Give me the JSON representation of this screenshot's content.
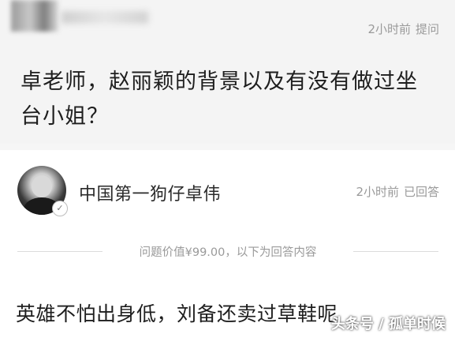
{
  "question": {
    "time_ago": "2小时前",
    "action": "提问",
    "text": "卓老师，赵丽颖的背景以及有没有做过坐台小姐？"
  },
  "answer": {
    "answerer_name": "中国第一狗仔卓伟",
    "time_ago": "2小时前",
    "status": "已回答",
    "price_note": "问题价值¥99.00，以下为回答内容",
    "text": "英雄不怕出身低，刘备还卖过草鞋呢"
  },
  "watermark": {
    "text": "头条号 / 孤单时候"
  }
}
